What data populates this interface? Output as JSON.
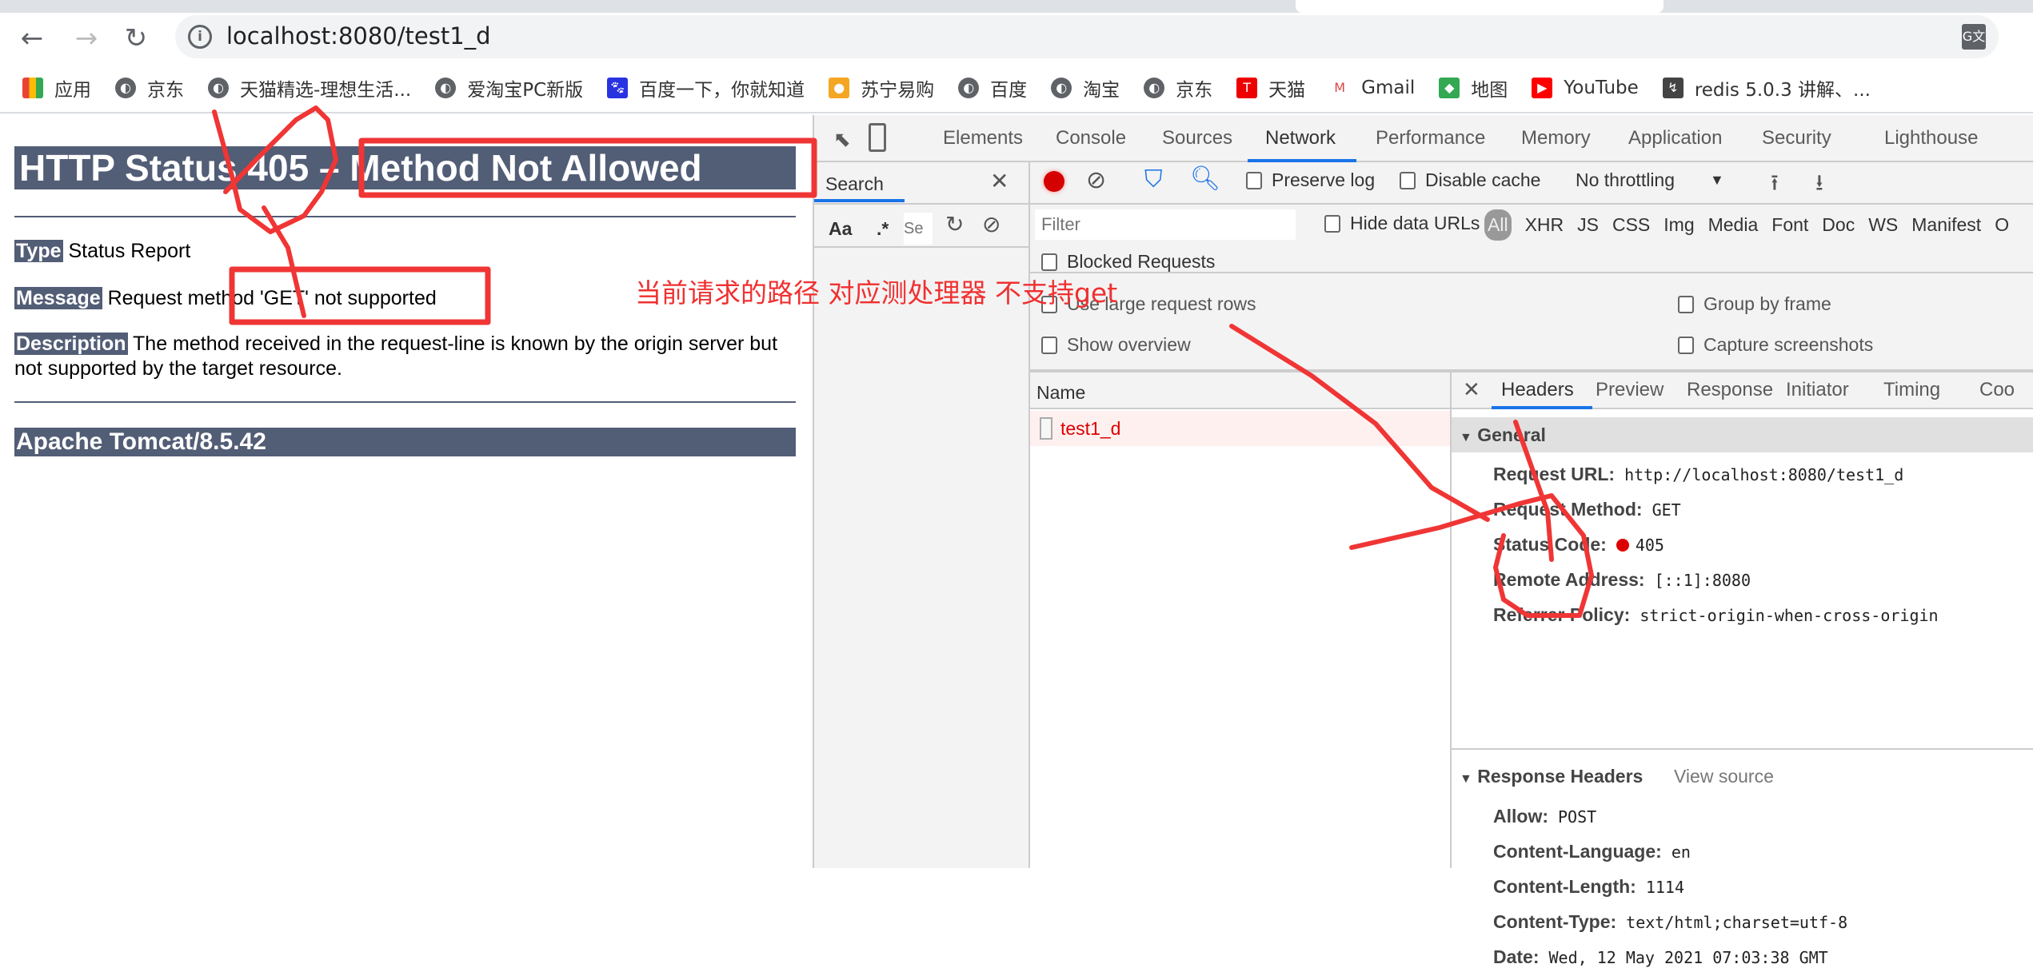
{
  "browser": {
    "url": "localhost:8080/test1_d",
    "bookmarks": [
      {
        "label": "应用",
        "icon": "apps-grid-icon"
      },
      {
        "label": "京东",
        "icon": "globe-icon"
      },
      {
        "label": "天猫精选-理想生活...",
        "icon": "globe-icon"
      },
      {
        "label": "爱淘宝PC新版",
        "icon": "globe-icon"
      },
      {
        "label": "百度一下，你就知道",
        "icon": "baidu-paw-icon"
      },
      {
        "label": "苏宁易购",
        "icon": "suning-lion-icon"
      },
      {
        "label": "百度",
        "icon": "globe-icon"
      },
      {
        "label": "淘宝",
        "icon": "globe-icon"
      },
      {
        "label": "京东",
        "icon": "globe-icon"
      },
      {
        "label": "天猫",
        "icon": "tmall-icon"
      },
      {
        "label": "Gmail",
        "icon": "gmail-icon"
      },
      {
        "label": "地图",
        "icon": "maps-icon"
      },
      {
        "label": "YouTube",
        "icon": "youtube-icon"
      },
      {
        "label": "redis 5.0.3 讲解、...",
        "icon": "bookmark-logo-icon"
      }
    ]
  },
  "page": {
    "title": "HTTP Status 405 – Method Not Allowed",
    "type_label": "Type",
    "type_value": "Status Report",
    "message_label": "Message",
    "message_value": "Request method 'GET' not supported",
    "description_label": "Description",
    "description_value": "The method received in the request-line is known by the origin server but not supported by the target resource.",
    "footer": "Apache Tomcat/8.5.42"
  },
  "annotation": {
    "text": "当前请求的路径 对应测处理器  不支持get",
    "color": "#f03030"
  },
  "devtools": {
    "tabs": [
      "Elements",
      "Console",
      "Sources",
      "Network",
      "Performance",
      "Memory",
      "Application",
      "Security",
      "Lighthouse"
    ],
    "active_tab": "Network",
    "search": {
      "title": "Search",
      "aa": "Aa",
      "regex": ".*",
      "input_placeholder": "Se"
    },
    "toolbar": {
      "preserve_log": "Preserve log",
      "disable_cache": "Disable cache",
      "throttling": "No throttling"
    },
    "filter": {
      "placeholder": "Filter",
      "hide_data_urls": "Hide data URLs",
      "types": [
        "All",
        "XHR",
        "JS",
        "CSS",
        "Img",
        "Media",
        "Font",
        "Doc",
        "WS",
        "Manifest",
        "O"
      ],
      "blocked_requests": "Blocked Requests"
    },
    "options": {
      "large_rows": "Use large request rows",
      "group_by_frame": "Group by frame",
      "show_overview": "Show overview",
      "capture_screenshots": "Capture screenshots"
    },
    "requests": {
      "column": "Name",
      "items": [
        "test1_d"
      ]
    },
    "details": {
      "tabs": [
        "Headers",
        "Preview",
        "Response",
        "Initiator",
        "Timing",
        "Coo"
      ],
      "active_tab": "Headers",
      "general_title": "General",
      "general": [
        {
          "key": "Request URL:",
          "value": "http://localhost:8080/test1_d"
        },
        {
          "key": "Request Method:",
          "value": "GET"
        },
        {
          "key": "Status Code:",
          "value": "405"
        },
        {
          "key": "Remote Address:",
          "value": "[::1]:8080"
        },
        {
          "key": "Referrer Policy:",
          "value": "strict-origin-when-cross-origin"
        }
      ],
      "response_title": "Response Headers",
      "view_source": "View source",
      "response": [
        {
          "key": "Allow:",
          "value": "POST"
        },
        {
          "key": "Content-Language:",
          "value": "en"
        },
        {
          "key": "Content-Length:",
          "value": "1114"
        },
        {
          "key": "Content-Type:",
          "value": "text/html;charset=utf-8"
        },
        {
          "key": "Date:",
          "value": "Wed, 12 May 2021 07:03:38 GMT"
        }
      ]
    }
  }
}
